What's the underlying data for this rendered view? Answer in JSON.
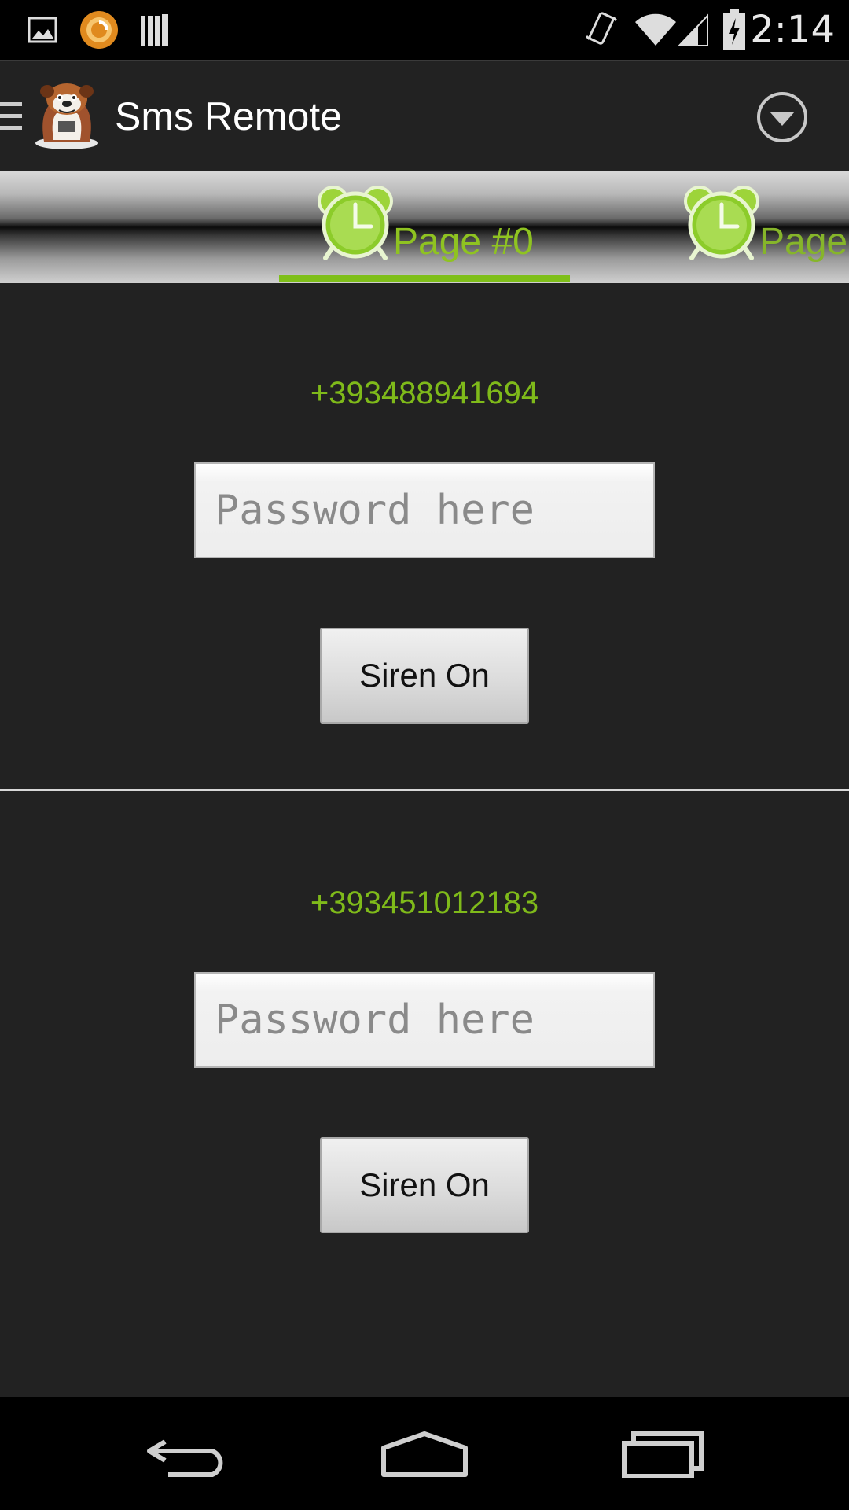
{
  "status_bar": {
    "time": "2:14",
    "icons": [
      "picture-icon",
      "sync-app-icon",
      "library-icon",
      "vibrate-icon",
      "wifi-icon",
      "signal-icon",
      "battery-charging-icon"
    ]
  },
  "action_bar": {
    "title": "Sms Remote",
    "icons": [
      "drawer-icon",
      "bulldog-logo",
      "overflow-dropdown-icon"
    ]
  },
  "tabs": [
    {
      "label": "Page #0",
      "icon": "alarm-clock-icon",
      "selected": true
    },
    {
      "label": "Page",
      "icon": "alarm-clock-icon",
      "selected": false
    }
  ],
  "entries": [
    {
      "phone": "+393488941694",
      "password_placeholder": "Password here",
      "button_label": "Siren On"
    },
    {
      "phone": "+393451012183",
      "password_placeholder": "Password here",
      "button_label": "Siren On"
    }
  ],
  "nav_bar": {
    "icons": [
      "back-icon",
      "home-icon",
      "recents-icon"
    ]
  },
  "colors": {
    "accent": "#7fba1a",
    "background": "#222222",
    "bars": "#000000"
  }
}
